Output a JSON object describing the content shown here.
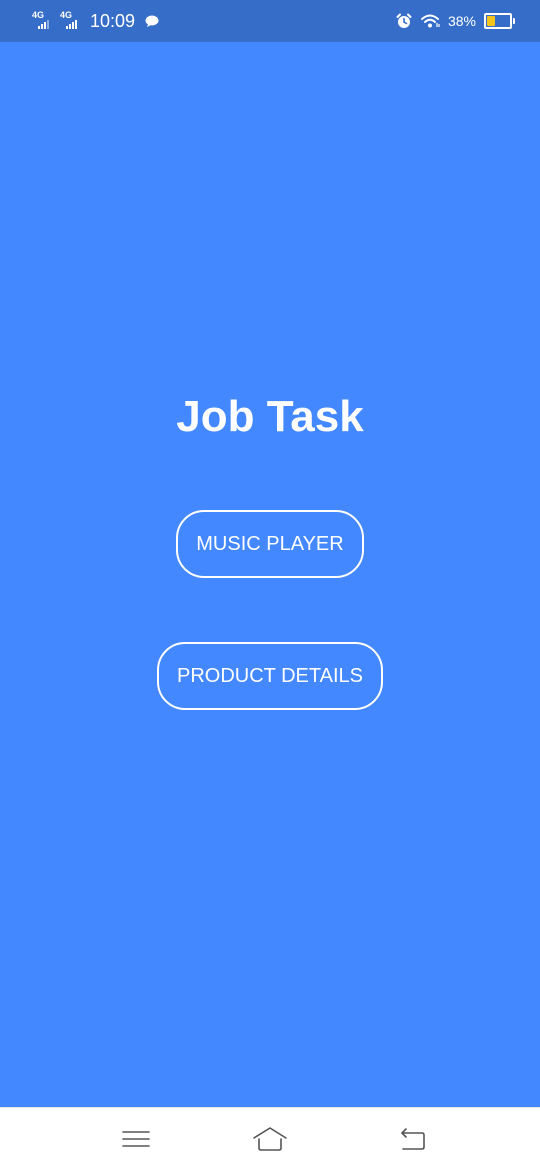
{
  "status_bar": {
    "sim1_network": "4G",
    "sim2_network": "4G",
    "time": "10:09",
    "battery_percent": "38%",
    "battery_level": 0.38,
    "battery_color": "#f4c51a",
    "icons": [
      "signal-icon",
      "signal-icon",
      "message-icon",
      "alarm-icon",
      "wifi-icon",
      "battery-icon"
    ]
  },
  "main": {
    "title": "Job Task",
    "buttons": [
      {
        "label": "MUSIC PLAYER"
      },
      {
        "label": "PRODUCT DETAILS"
      }
    ]
  },
  "nav_bar": {
    "icons": [
      "menu-icon",
      "home-icon",
      "back-icon"
    ]
  },
  "colors": {
    "background": "#4388fe",
    "status_bar": "#356dc8",
    "text": "#ffffff"
  }
}
